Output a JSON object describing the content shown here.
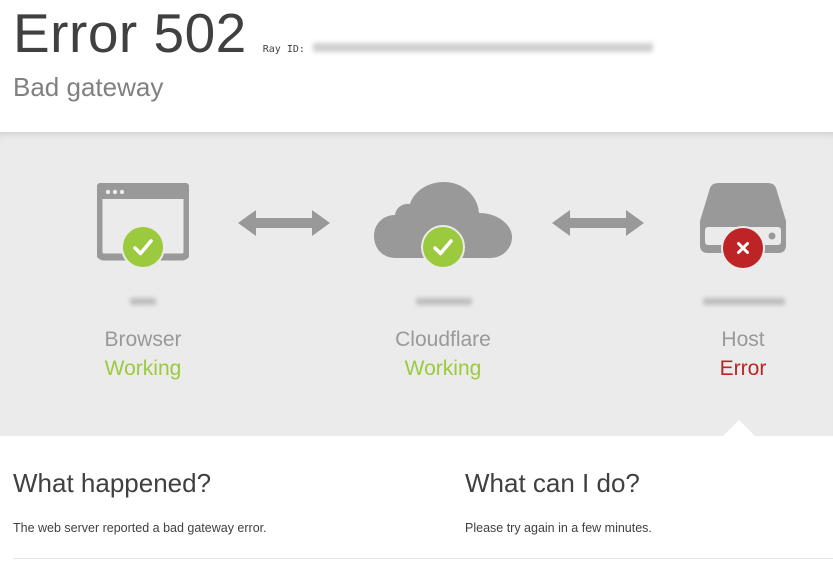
{
  "header": {
    "error_code": "Error 502",
    "ray_label": "Ray ID:",
    "subtitle": "Bad gateway"
  },
  "nodes": [
    {
      "label": "Browser",
      "status": "Working",
      "status_type": "ok",
      "icon": "browser-window-icon"
    },
    {
      "label": "Cloudflare",
      "status": "Working",
      "status_type": "ok",
      "icon": "cloud-icon"
    },
    {
      "label": "Host",
      "status": "Error",
      "status_type": "error",
      "icon": "server-icon"
    }
  ],
  "colors": {
    "icon_gray": "#999999",
    "ok_green": "#9bca3e",
    "error_red": "#bd2426",
    "band_bg": "#ebebeb"
  },
  "what_happened": {
    "heading": "What happened?",
    "text": "The web server reported a bad gateway error."
  },
  "what_can_i_do": {
    "heading": "What can I do?",
    "text": "Please try again in a few minutes."
  }
}
